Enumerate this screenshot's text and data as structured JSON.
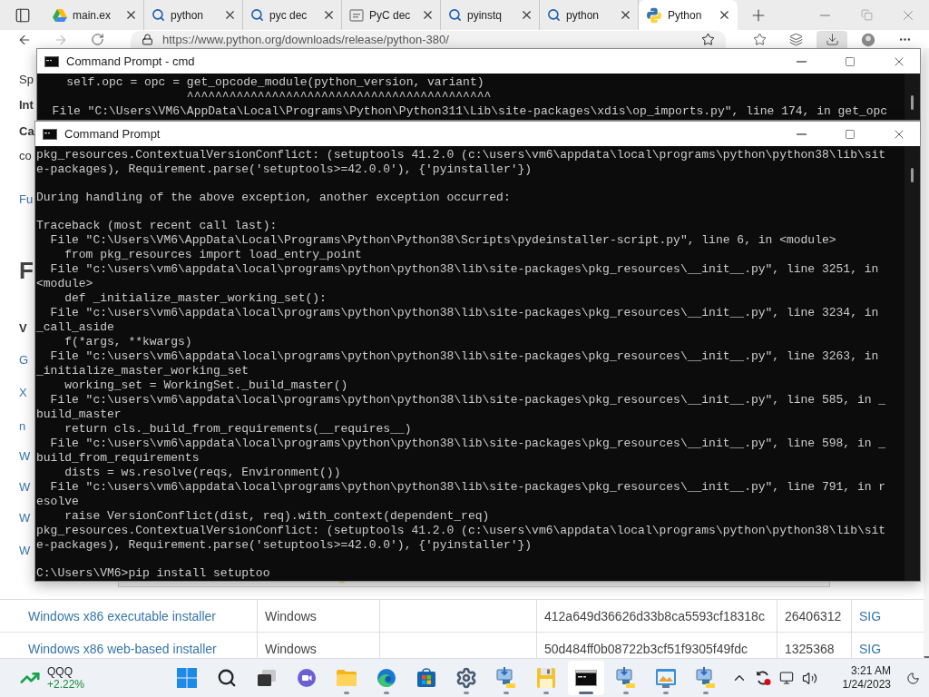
{
  "browser": {
    "tabs": [
      {
        "label": "main.ex",
        "kind": "drive",
        "selected": false
      },
      {
        "label": "python",
        "kind": "search",
        "selected": false
      },
      {
        "label": "pyc dec",
        "kind": "search",
        "selected": false
      },
      {
        "label": "PyC dec",
        "kind": "document",
        "selected": false
      },
      {
        "label": "pyinstq",
        "kind": "search",
        "selected": false
      },
      {
        "label": "python",
        "kind": "search",
        "selected": false
      },
      {
        "label": "Python",
        "kind": "python",
        "selected": true
      }
    ],
    "address": "https://www.python.org/downloads/release/python-380/",
    "page": {
      "fragments": [
        {
          "text": "Sp",
          "kind": "text"
        },
        {
          "text": "Int",
          "kind": "bold"
        },
        {
          "text": "Ca",
          "kind": "bold"
        },
        {
          "text": "co",
          "kind": "text"
        },
        {
          "text": "Fu",
          "kind": "link"
        },
        {
          "text": "F",
          "kind": "heading"
        },
        {
          "text": "V",
          "kind": "bold"
        },
        {
          "text": "G",
          "kind": "link"
        },
        {
          "text": "X",
          "kind": "link"
        },
        {
          "text": "n",
          "kind": "link"
        },
        {
          "text": "W",
          "kind": "link"
        },
        {
          "text": "W",
          "kind": "link"
        },
        {
          "text": "W",
          "kind": "link"
        },
        {
          "text": "W",
          "kind": "link"
        }
      ],
      "table_rows": [
        {
          "column_1": "Windows x86 executable installer",
          "column_2": "Windows",
          "column_4": "412a649d36626d33b8ca5593cf18318c",
          "column_5": "26406312",
          "column_6": "SIG"
        },
        {
          "column_1": "Windows x86 web-based installer",
          "column_2": "Windows",
          "column_4": "50d484ff0b08722b3cf51f9305f49fdc",
          "column_5": "1325368",
          "column_6": "SIG"
        }
      ]
    }
  },
  "windows": [
    {
      "title": "Command Prompt - cmd",
      "blocks": [
        [
          "    self.opc = opc = get_opcode_module(python_version, variant)",
          "                     ^^^^^^^^^^^^^^^^^^^^^^^^^^^^^^^^^^^^^^^^^^^",
          "  File \"C:\\Users\\VM6\\AppData\\Local\\Programs\\Python\\Python311\\Lib\\site-packages\\xdis\\op_imports.py\", line 174, in get_opc"
        ]
      ]
    },
    {
      "title": "Command Prompt",
      "blocks": [
        [
          "pkg_resources.ContextualVersionConflict: (setuptools 41.2.0 (c:\\users\\vm6\\appdata\\local\\programs\\python\\python38\\lib\\sit",
          "e-packages), Requirement.parse('setuptools>=42.0.0'), {'pyinstaller'})"
        ],
        [
          "During handling of the above exception, another exception occurred:"
        ],
        [
          "Traceback (most recent call last):",
          "  File \"C:\\Users\\VM6\\AppData\\Local\\Programs\\Python\\Python38\\Scripts\\pydeinstaller-script.py\", line 6, in <module>",
          "    from pkg_resources import load_entry_point",
          "  File \"c:\\users\\vm6\\appdata\\local\\programs\\python\\python38\\lib\\site-packages\\pkg_resources\\__init__.py\", line 3251, in",
          "<module>",
          "    def _initialize_master_working_set():",
          "  File \"c:\\users\\vm6\\appdata\\local\\programs\\python\\python38\\lib\\site-packages\\pkg_resources\\__init__.py\", line 3234, in",
          "_call_aside",
          "    f(*args, **kwargs)",
          "  File \"c:\\users\\vm6\\appdata\\local\\programs\\python\\python38\\lib\\site-packages\\pkg_resources\\__init__.py\", line 3263, in",
          "_initialize_master_working_set",
          "    working_set = WorkingSet._build_master()",
          "  File \"c:\\users\\vm6\\appdata\\local\\programs\\python\\python38\\lib\\site-packages\\pkg_resources\\__init__.py\", line 585, in _",
          "build_master",
          "    return cls._build_from_requirements(__requires__)",
          "  File \"c:\\users\\vm6\\appdata\\local\\programs\\python\\python38\\lib\\site-packages\\pkg_resources\\__init__.py\", line 598, in _",
          "build_from_requirements",
          "    dists = ws.resolve(reqs, Environment())",
          "  File \"c:\\users\\vm6\\appdata\\local\\programs\\python\\python38\\lib\\site-packages\\pkg_resources\\__init__.py\", line 791, in r",
          "esolve",
          "    raise VersionConflict(dist, req).with_context(dependent_req)",
          "pkg_resources.ContextualVersionConflict: (setuptools 41.2.0 (c:\\users\\vm6\\appdata\\local\\programs\\python\\python38\\lib\\sit",
          "e-packages), Requirement.parse('setuptools>=42.0.0'), {'pyinstaller'})"
        ],
        [
          "C:\\Users\\VM6>pip install setuptoo"
        ]
      ]
    }
  ],
  "taskbar": {
    "widget": {
      "symbol": "QQQ",
      "change": "+2.22%"
    },
    "apps": [
      {
        "kind": "start",
        "running": false,
        "selected": false
      },
      {
        "kind": "search",
        "running": false,
        "selected": false
      },
      {
        "kind": "task-view",
        "running": false,
        "selected": false
      },
      {
        "kind": "chat",
        "running": false,
        "selected": false
      },
      {
        "kind": "explorer",
        "running": true,
        "selected": false
      },
      {
        "kind": "edge",
        "running": true,
        "selected": false
      },
      {
        "kind": "store",
        "running": false,
        "selected": false
      },
      {
        "kind": "settings",
        "running": true,
        "selected": false
      },
      {
        "kind": "installer",
        "running": true,
        "selected": false
      },
      {
        "kind": "floppy",
        "running": true,
        "selected": false
      },
      {
        "kind": "terminal",
        "running": true,
        "selected": true
      },
      {
        "kind": "installer",
        "running": true,
        "selected": false
      },
      {
        "kind": "image-viewer",
        "running": true,
        "selected": false
      },
      {
        "kind": "installer",
        "running": true,
        "selected": false
      }
    ],
    "clock": {
      "time": "3:21 AM",
      "date": "1/24/2023"
    }
  }
}
